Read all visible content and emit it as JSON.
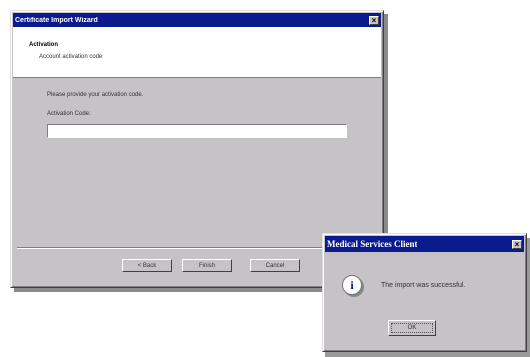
{
  "wizard": {
    "title": "Certificate Import Wizard",
    "close_glyph": "×",
    "header_title": "Activation",
    "header_subtitle": "Account activation code",
    "instruction": "Please provide your activation code.",
    "field_label": "Activation Code:",
    "field_value": "",
    "buttons": {
      "back": "< Back",
      "finish": "Finish",
      "cancel": "Cancel"
    }
  },
  "message_box": {
    "title": "Medical Services Client",
    "close_glyph": "×",
    "icon": "info-icon",
    "icon_glyph": "i",
    "message": "The import was successful.",
    "ok_label": "OK"
  },
  "colors": {
    "title_bar": "#0b1a8c",
    "face": "#c6c3c6"
  }
}
